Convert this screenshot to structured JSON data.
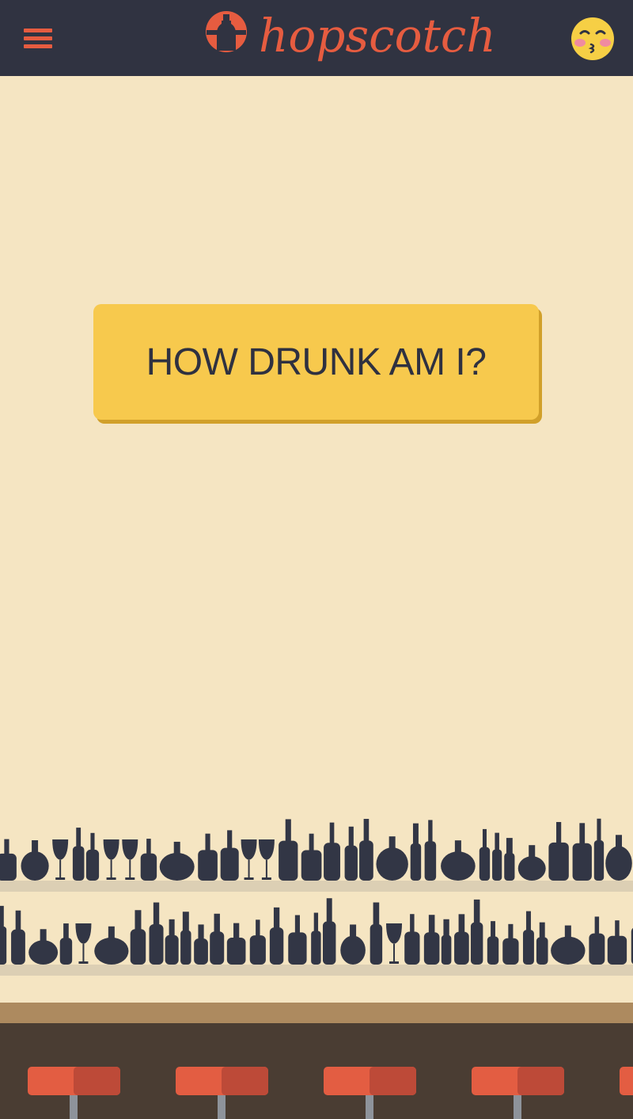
{
  "header": {
    "menu_icon": "hamburger-menu-icon",
    "logo_text": "hopscotch",
    "logo_icon": "bottle-badge-icon",
    "avatar_icon": "kissing-face-emoji-icon"
  },
  "main": {
    "button_label": "HOW DRUNK AM I?"
  },
  "colors": {
    "header_bg": "#303341",
    "accent": "#e65c40",
    "page_bg": "#f5e5c2",
    "button_bg": "#f7c94d",
    "button_shadow": "#d1a02a",
    "bottle": "#323645",
    "counter_top": "#ad8a5f",
    "counter_front": "#4a3d33",
    "stool_seat": "#e35d42"
  }
}
